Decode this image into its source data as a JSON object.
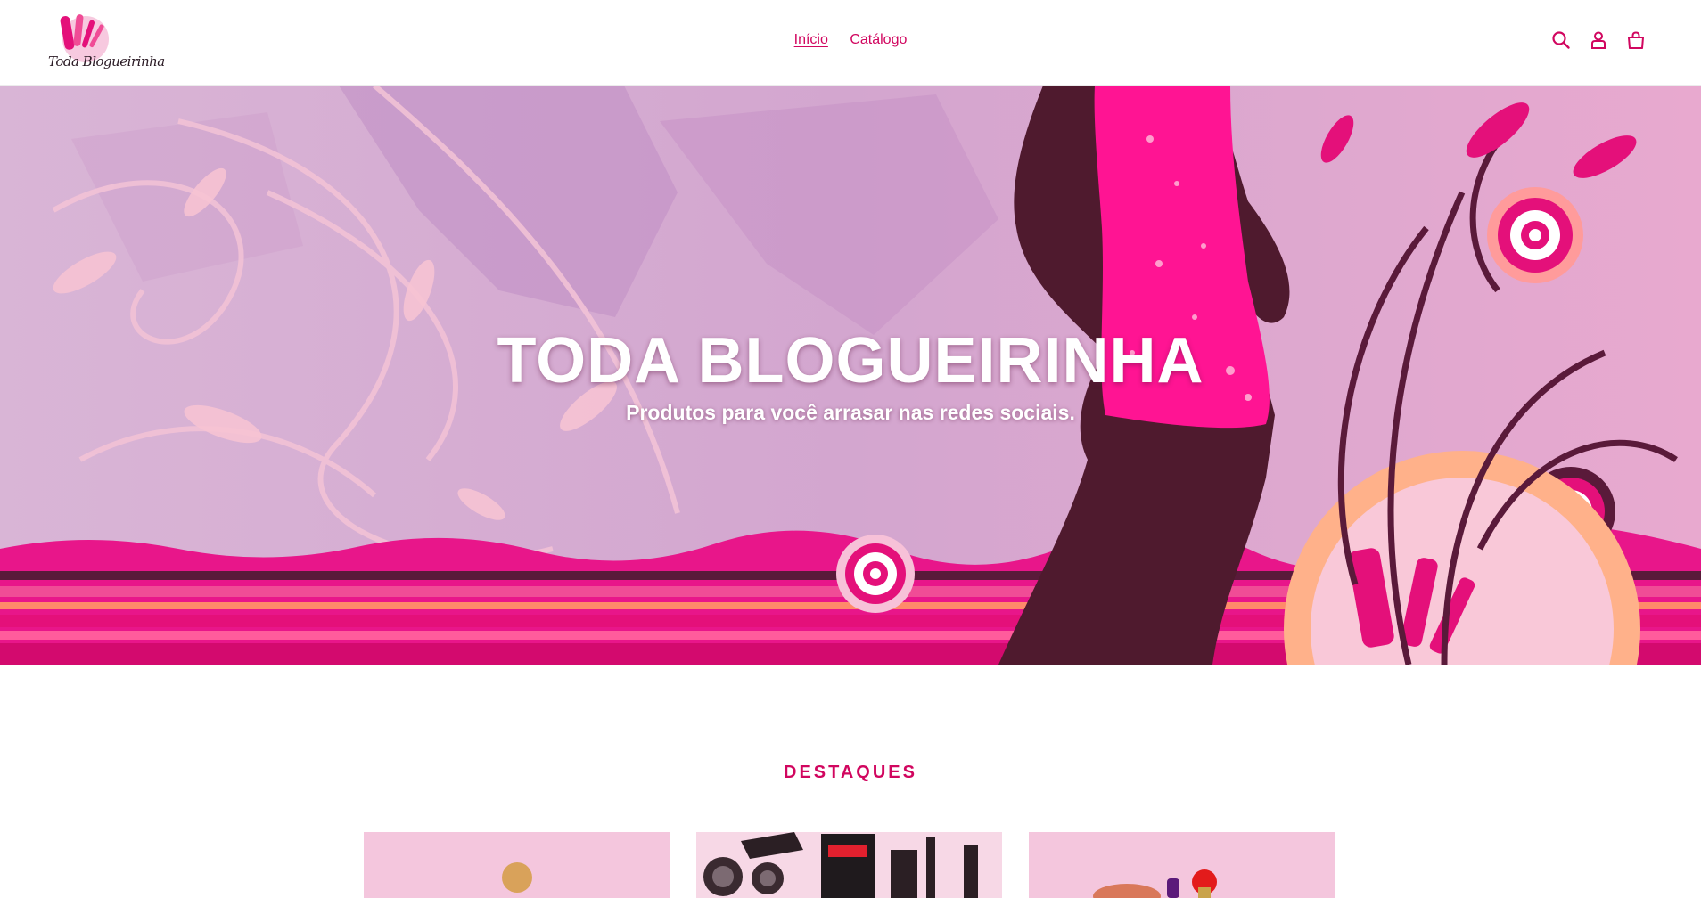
{
  "brand": {
    "logo_text": "Toda Blogueirinha",
    "accent_color": "#d1065f"
  },
  "nav": {
    "items": [
      {
        "label": "Início",
        "active": true
      },
      {
        "label": "Catálogo",
        "active": false
      }
    ]
  },
  "header_icons": [
    "search-icon",
    "account-icon",
    "cart-icon"
  ],
  "hero": {
    "title": "TODA BLOGUEIRINHA",
    "subtitle": "Produtos para você arrasar nas redes sociais."
  },
  "featured": {
    "title": "DESTAQUES",
    "products": [
      {
        "image": "makeup-sponge-image"
      },
      {
        "image": "phone-lens-kit-image"
      },
      {
        "image": "makeup-products-image"
      }
    ]
  }
}
